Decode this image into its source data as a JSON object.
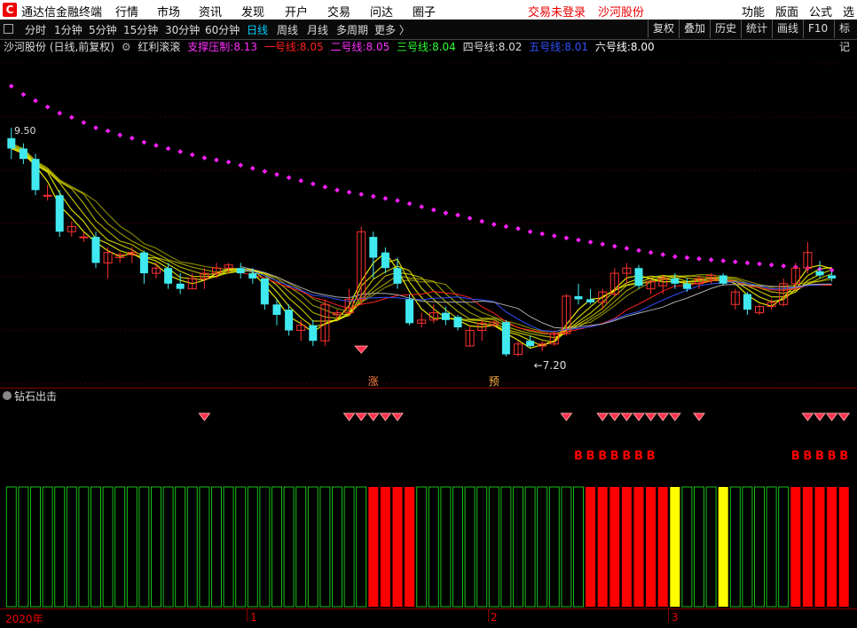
{
  "menubar": {
    "logo": "C",
    "app_title": "通达信金融终端",
    "items": [
      "行情",
      "市场",
      "资讯",
      "发现",
      "开户",
      "交易",
      "问达",
      "圈子"
    ],
    "trade_status": "交易未登录",
    "stock_name": "沙河股份",
    "right_items": [
      "功能",
      "版面",
      "公式",
      "选股"
    ]
  },
  "toolbar": {
    "periods": [
      "分时",
      "1分钟",
      "5分钟",
      "15分钟",
      "30分钟",
      "60分钟",
      "日线",
      "周线",
      "月线",
      "多周期",
      "更多 〉"
    ],
    "active": "日线",
    "right_buttons": [
      "复权",
      "叠加",
      "历史",
      "统计",
      "画线",
      "F10",
      "标记"
    ]
  },
  "infobar": {
    "stock": "沙河股份 (日线,前复权)",
    "indicator": "红利滚滚",
    "support_label": "支撑压制:",
    "support_value": "8.13",
    "l1_label": "一号线:",
    "l1_value": "8.05",
    "l2_label": "二号线:",
    "l2_value": "8.05",
    "l3_label": "三号线:",
    "l3_value": "8.04",
    "l4_label": "四号线:",
    "l4_value": "8.02",
    "l5_label": "五号线:",
    "l5_value": "8.01",
    "l6_label": "六号线:",
    "l6_value": "8.00"
  },
  "colors": {
    "up": "#ff3030",
    "down": "#40e8f0",
    "support": "#ff20ff",
    "ma": "#ffff00",
    "green": "#19c019",
    "red": "#ff0000",
    "yellow": "#ffff00"
  },
  "annotations": {
    "high_label": "9.50",
    "low_label": "7.20",
    "zhang": "涨",
    "yu": "预"
  },
  "subpanel": {
    "title": "钻石出击",
    "b_label": "B"
  },
  "bottom": {
    "ticks": [
      "2020年",
      "1",
      "2",
      "3"
    ]
  },
  "chart_data": {
    "type": "candlestick",
    "series": [
      {
        "name": "K线",
        "ohlc": [
          [
            9.4,
            9.5,
            9.2,
            9.3
          ],
          [
            9.3,
            9.35,
            9.15,
            9.2
          ],
          [
            9.2,
            9.25,
            8.85,
            8.9
          ],
          [
            8.85,
            8.95,
            8.8,
            8.85
          ],
          [
            8.85,
            8.9,
            8.45,
            8.5
          ],
          [
            8.5,
            8.6,
            8.45,
            8.55
          ],
          [
            8.45,
            8.5,
            8.4,
            8.45
          ],
          [
            8.45,
            8.5,
            8.15,
            8.2
          ],
          [
            8.2,
            8.35,
            8.05,
            8.3
          ],
          [
            8.25,
            8.3,
            8.2,
            8.28
          ],
          [
            8.28,
            8.35,
            8.2,
            8.3
          ],
          [
            8.3,
            8.32,
            8.0,
            8.1
          ],
          [
            8.1,
            8.2,
            8.05,
            8.15
          ],
          [
            8.15,
            8.2,
            7.95,
            8.0
          ],
          [
            8.0,
            8.1,
            7.9,
            7.95
          ],
          [
            7.95,
            8.1,
            7.95,
            8.05
          ],
          [
            8.05,
            8.15,
            7.95,
            8.1
          ],
          [
            8.1,
            8.2,
            8.05,
            8.15
          ],
          [
            8.15,
            8.2,
            8.1,
            8.18
          ],
          [
            8.15,
            8.2,
            8.05,
            8.1
          ],
          [
            8.1,
            8.15,
            8.0,
            8.05
          ],
          [
            8.05,
            8.05,
            7.75,
            7.8
          ],
          [
            7.8,
            7.85,
            7.6,
            7.7
          ],
          [
            7.75,
            7.8,
            7.5,
            7.55
          ],
          [
            7.55,
            7.65,
            7.45,
            7.6
          ],
          [
            7.6,
            7.65,
            7.4,
            7.45
          ],
          [
            7.45,
            7.85,
            7.4,
            7.8
          ],
          [
            7.7,
            7.75,
            7.65,
            7.72
          ],
          [
            7.72,
            7.95,
            7.7,
            7.85
          ],
          [
            7.85,
            8.55,
            7.8,
            8.5
          ],
          [
            8.45,
            8.5,
            8.05,
            8.25
          ],
          [
            8.3,
            8.35,
            8.1,
            8.15
          ],
          [
            8.15,
            8.25,
            7.95,
            8.0
          ],
          [
            7.85,
            7.9,
            7.6,
            7.62
          ],
          [
            7.62,
            7.72,
            7.58,
            7.65
          ],
          [
            7.65,
            7.8,
            7.62,
            7.72
          ],
          [
            7.72,
            7.78,
            7.6,
            7.65
          ],
          [
            7.68,
            7.7,
            7.55,
            7.58
          ],
          [
            7.4,
            7.6,
            7.4,
            7.55
          ],
          [
            7.55,
            7.65,
            7.45,
            7.62
          ],
          [
            7.6,
            7.65,
            7.58,
            7.63
          ],
          [
            7.63,
            7.65,
            7.3,
            7.32
          ],
          [
            7.32,
            7.45,
            7.3,
            7.42
          ],
          [
            7.45,
            7.5,
            7.38,
            7.4
          ],
          [
            7.4,
            7.45,
            7.35,
            7.42
          ],
          [
            7.42,
            7.55,
            7.4,
            7.52
          ],
          [
            7.52,
            7.9,
            7.5,
            7.88
          ],
          [
            7.88,
            8.0,
            7.8,
            7.85
          ],
          [
            7.85,
            7.95,
            7.8,
            7.82
          ],
          [
            7.82,
            7.95,
            7.75,
            7.92
          ],
          [
            7.9,
            8.15,
            7.88,
            8.1
          ],
          [
            8.1,
            8.2,
            8.0,
            8.15
          ],
          [
            8.15,
            8.18,
            7.95,
            7.98
          ],
          [
            7.95,
            8.05,
            7.9,
            8.02
          ],
          [
            7.98,
            8.08,
            7.9,
            8.05
          ],
          [
            8.05,
            8.1,
            7.95,
            8.0
          ],
          [
            8.0,
            8.05,
            7.92,
            7.95
          ],
          [
            8.0,
            8.08,
            7.95,
            8.05
          ],
          [
            8.05,
            8.1,
            8.0,
            8.08
          ],
          [
            8.08,
            8.1,
            7.98,
            8.0
          ],
          [
            7.8,
            7.95,
            7.75,
            7.92
          ],
          [
            7.9,
            7.92,
            7.7,
            7.75
          ],
          [
            7.72,
            7.8,
            7.7,
            7.78
          ],
          [
            7.78,
            7.85,
            7.75,
            7.82
          ],
          [
            7.8,
            8.05,
            7.78,
            8.0
          ],
          [
            8.0,
            8.2,
            7.95,
            8.15
          ],
          [
            8.15,
            8.4,
            8.1,
            8.3
          ],
          [
            8.12,
            8.22,
            8.05,
            8.08
          ],
          [
            8.08,
            8.12,
            8.02,
            8.05
          ]
        ]
      },
      {
        "name": "支撑压制",
        "values": [
          9.9,
          9.82,
          9.76,
          9.7,
          9.64,
          9.6,
          9.55,
          9.5,
          9.47,
          9.43,
          9.4,
          9.36,
          9.33,
          9.3,
          9.27,
          9.24,
          9.21,
          9.19,
          9.17,
          9.14,
          9.11,
          9.08,
          9.05,
          9.02,
          8.99,
          8.96,
          8.93,
          8.9,
          8.88,
          8.86,
          8.84,
          8.82,
          8.8,
          8.77,
          8.74,
          8.71,
          8.68,
          8.66,
          8.63,
          8.6,
          8.57,
          8.55,
          8.53,
          8.5,
          8.48,
          8.46,
          8.44,
          8.42,
          8.4,
          8.38,
          8.36,
          8.34,
          8.32,
          8.3,
          8.28,
          8.26,
          8.25,
          8.24,
          8.23,
          8.22,
          8.21,
          8.2,
          8.19,
          8.18,
          8.17,
          8.16,
          8.15,
          8.14,
          8.13
        ]
      }
    ],
    "signals": {
      "diamonds": [
        16,
        28,
        29,
        30,
        31,
        32,
        46,
        49,
        50,
        51,
        52,
        53,
        54,
        55,
        57,
        66,
        67,
        68,
        69
      ],
      "b_markers": [
        47,
        48,
        49,
        50,
        51,
        52,
        53,
        65,
        66,
        67,
        68,
        69
      ],
      "bars": [
        "g",
        "g",
        "g",
        "g",
        "g",
        "g",
        "g",
        "g",
        "g",
        "g",
        "g",
        "g",
        "g",
        "g",
        "g",
        "g",
        "g",
        "g",
        "g",
        "g",
        "g",
        "g",
        "g",
        "g",
        "g",
        "g",
        "g",
        "g",
        "g",
        "g",
        "r",
        "r",
        "r",
        "r",
        "g",
        "g",
        "g",
        "g",
        "g",
        "g",
        "g",
        "g",
        "g",
        "g",
        "g",
        "g",
        "g",
        "g",
        "r",
        "r",
        "r",
        "r",
        "r",
        "r",
        "r",
        "y",
        "g",
        "g",
        "g",
        "y",
        "g",
        "g",
        "g",
        "g",
        "g",
        "r",
        "r",
        "r",
        "r",
        "r"
      ]
    },
    "ylim": [
      7.0,
      10.2
    ]
  }
}
